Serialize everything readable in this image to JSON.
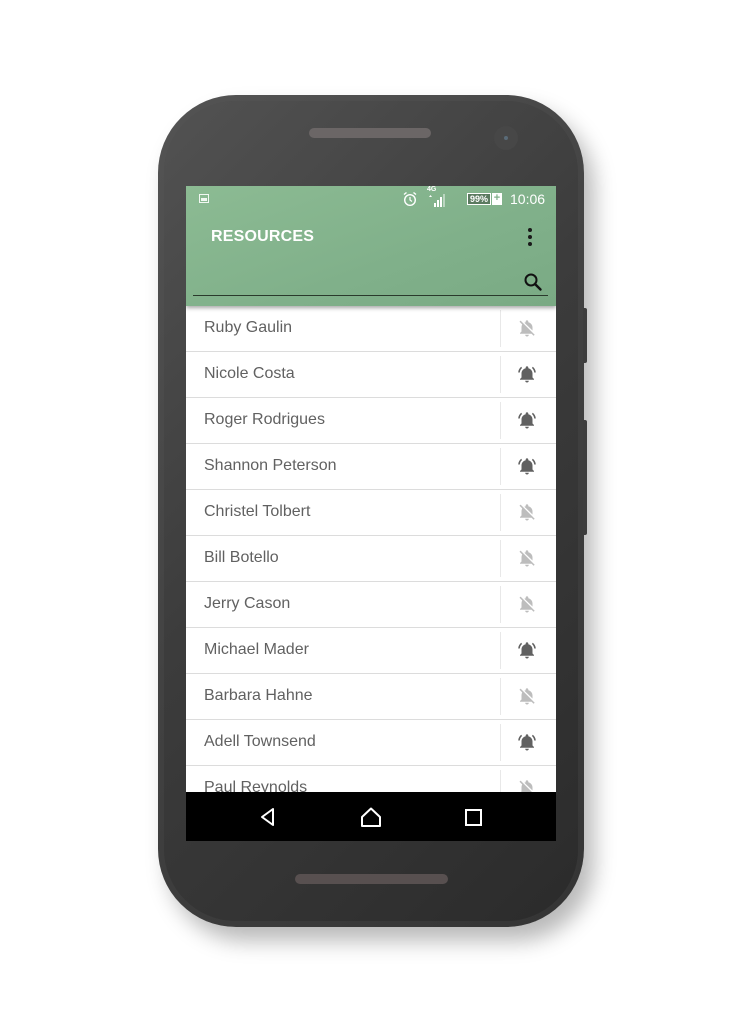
{
  "status_bar": {
    "notification_icon": "image-icon",
    "alarm_icon": "alarm-clock-icon",
    "network_type": "4G",
    "signal_icon": "cell-signal-icon",
    "battery_percent": "99%",
    "battery_charging_symbol": "+",
    "time": "10:06"
  },
  "app_bar": {
    "title": "RESOURCES",
    "overflow_icon": "more-vert-icon",
    "search": {
      "value": "",
      "placeholder": "",
      "icon": "search-icon"
    }
  },
  "colors": {
    "app_bar": "#82b28b",
    "bell_active": "#616161",
    "bell_muted": "#bdbdbd",
    "text": "#616161",
    "navbar": "#000000"
  },
  "resources": [
    {
      "name": "Ruby Gaulin",
      "notifications": "off"
    },
    {
      "name": "Nicole Costa",
      "notifications": "on"
    },
    {
      "name": "Roger Rodrigues",
      "notifications": "on"
    },
    {
      "name": "Shannon Peterson",
      "notifications": "on"
    },
    {
      "name": "Christel Tolbert",
      "notifications": "off"
    },
    {
      "name": "Bill Botello",
      "notifications": "off"
    },
    {
      "name": "Jerry Cason",
      "notifications": "off"
    },
    {
      "name": "Michael Mader",
      "notifications": "on"
    },
    {
      "name": "Barbara Hahne",
      "notifications": "off"
    },
    {
      "name": "Adell Townsend",
      "notifications": "on"
    },
    {
      "name": "Paul Reynolds",
      "notifications": "off"
    }
  ],
  "nav_bar": {
    "back_icon": "back-triangle-icon",
    "home_icon": "home-icon",
    "recents_icon": "recents-square-icon"
  }
}
